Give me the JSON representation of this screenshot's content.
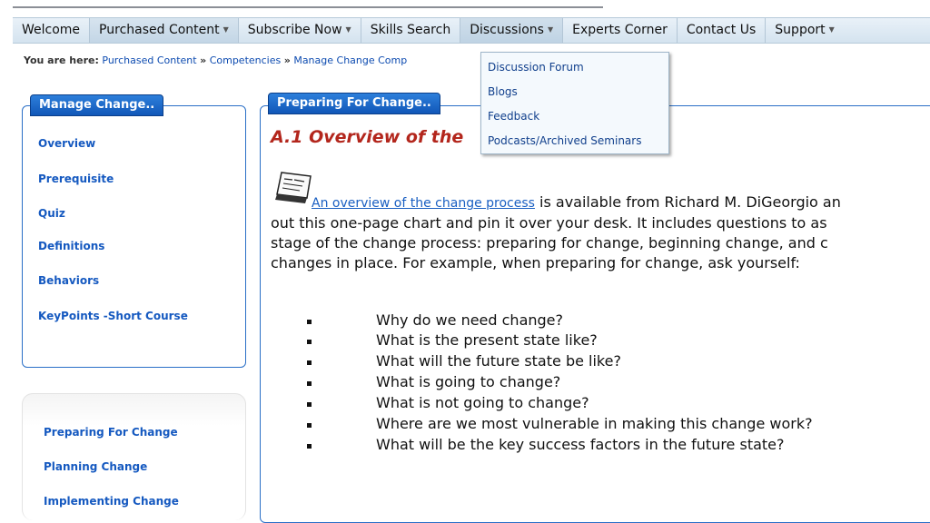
{
  "nav": {
    "items": [
      {
        "label": "Welcome",
        "has_menu": false
      },
      {
        "label": "Purchased Content",
        "has_menu": true
      },
      {
        "label": "Subscribe Now",
        "has_menu": true
      },
      {
        "label": "Skills Search",
        "has_menu": false
      },
      {
        "label": "Discussions",
        "has_menu": true
      },
      {
        "label": "Experts Corner",
        "has_menu": false
      },
      {
        "label": "Contact Us",
        "has_menu": false
      },
      {
        "label": "Support",
        "has_menu": true
      }
    ],
    "caret": "▼"
  },
  "breadcrumb": {
    "prefix": "You are here:",
    "links": [
      "Purchased Content",
      "Competencies",
      "Manage Change Comp"
    ],
    "separator": "»"
  },
  "dropdown": {
    "items": [
      "Discussion Forum",
      "Blogs",
      "Feedback",
      "Podcasts/Archived Seminars"
    ]
  },
  "sidebar": {
    "title": "Manage Change..",
    "links": [
      "Overview",
      "Prerequisite",
      "Quiz",
      "Definitions",
      "Behaviors",
      "KeyPoints -Short Course"
    ]
  },
  "sidebar2": {
    "links": [
      "Preparing For Change",
      "Planning Change",
      "Implementing Change"
    ]
  },
  "content": {
    "tab": "Preparing For Change..",
    "title": "A.1 Overview of the",
    "link_text": "An overview of the change process",
    "para_lines": [
      " is available from Richard M. DiGeorgio an",
      "out this one-page chart and pin it over your desk. It includes questions to as",
      "stage of the change process: preparing for change, beginning change, and c",
      "changes in place. For example, when preparing for change, ask yourself:"
    ],
    "bullets": [
      "Why do we need change?",
      "What is the present state like?",
      "What will the future state be like?",
      "What is going to change?",
      "What is not going to change?",
      "Where are we most vulnerable in making this change work?",
      "What will be the key success factors in the future state?"
    ]
  },
  "colors": {
    "accent": "#1559c0",
    "title_red": "#b3261c",
    "tab_blue": "#1f6fd0"
  }
}
